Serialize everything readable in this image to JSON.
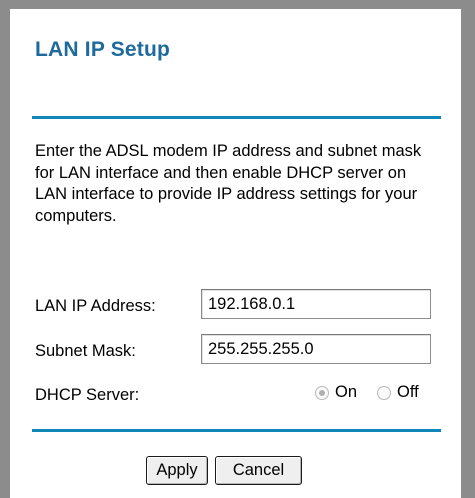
{
  "page": {
    "title": "LAN IP Setup",
    "description": "Enter the ADSL modem IP address and subnet mask for LAN interface and then enable DHCP server on LAN interface to provide IP address settings for your computers."
  },
  "form": {
    "lan_ip_label": "LAN IP Address:",
    "lan_ip_value": "192.168.0.1",
    "subnet_label": "Subnet Mask:",
    "subnet_value": "255.255.255.0",
    "dhcp_label": "DHCP Server:",
    "dhcp_options": [
      {
        "label": "On",
        "checked": true
      },
      {
        "label": "Off",
        "checked": false
      }
    ]
  },
  "buttons": {
    "apply": "Apply",
    "cancel": "Cancel"
  },
  "colors": {
    "title": "#1f6a9c",
    "rule": "#0f86b8",
    "frame": "#8c8c8c"
  }
}
